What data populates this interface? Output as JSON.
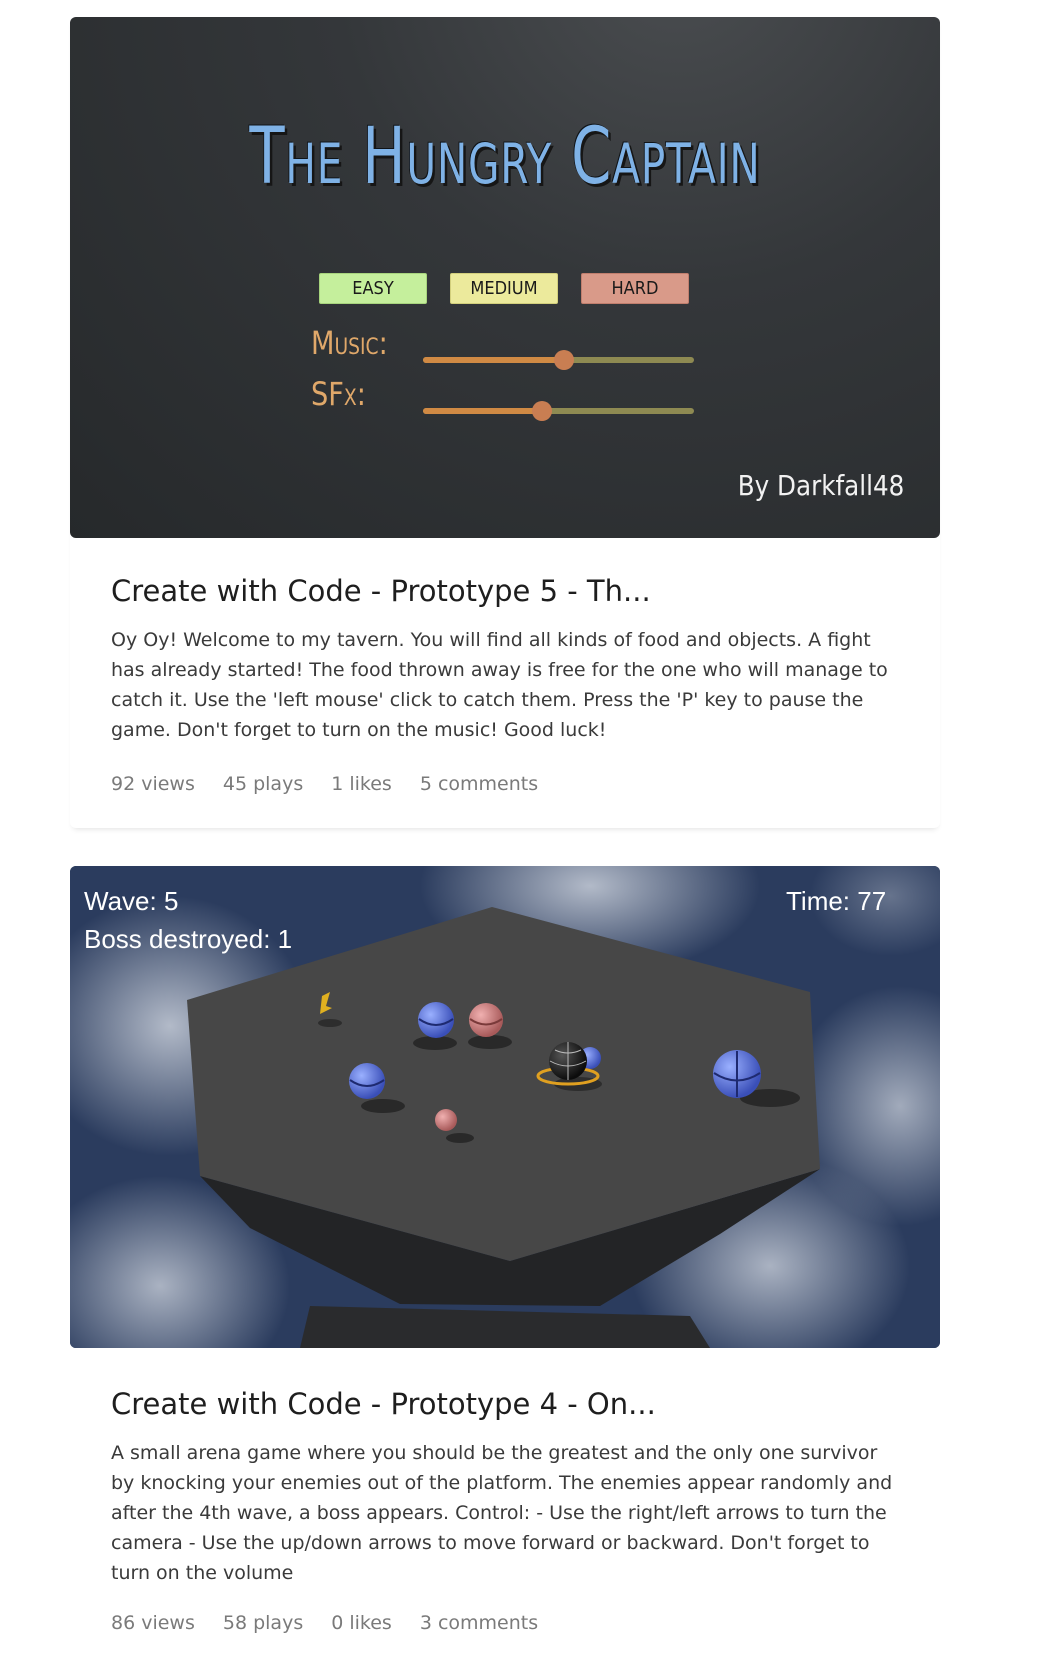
{
  "projects": [
    {
      "thumbnail": {
        "game_title": "The Hungry Captain",
        "difficulty_buttons": [
          "EASY",
          "MEDIUM",
          "HARD"
        ],
        "colors": {
          "easy": "#c5ef9c",
          "medium": "#ecea9c",
          "hard": "#d99a89",
          "title": "#7fb2e6",
          "slider": "#d08a44"
        },
        "music_label": "Music:",
        "music_level": 0.52,
        "sfx_label": "SFx:",
        "sfx_level": 0.44,
        "byline": "By Darkfall48"
      },
      "title": "Create with Code - Prototype 5 - Th...",
      "description": "Oy Oy! Welcome to my tavern. You will find all kinds of food and objects. A fight has already started! The food thrown away is free for the one who will manage to catch it. Use the 'left mouse' click to catch them. Press the 'P' key to pause the game. Don't forget to turn on the music! Good luck!",
      "views": "92 views",
      "plays": "45 plays",
      "likes": "1 likes",
      "comments": "5 comments"
    },
    {
      "thumbnail": {
        "wave": "Wave: 5",
        "boss": "Boss destroyed: 1",
        "time": "Time: 77"
      },
      "title": "Create with Code - Prototype 4 - On...",
      "description": "A small arena game where you should be the greatest and the only one survivor by knocking your enemies out of the platform. The enemies appear randomly and after the 4th wave, a boss appears. Control: - Use the right/left arrows to turn the camera - Use the up/down arrows to move forward or backward. Don't forget to turn on the volume",
      "views": "86 views",
      "plays": "58 plays",
      "likes": "0 likes",
      "comments": "3 comments"
    }
  ]
}
